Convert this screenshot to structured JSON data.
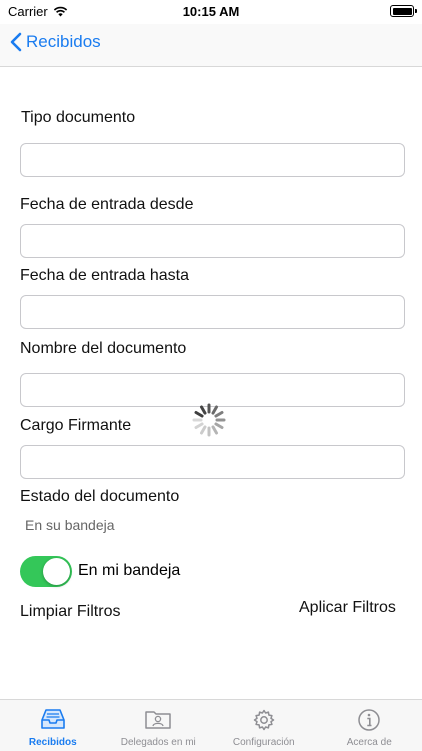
{
  "status_bar": {
    "carrier": "Carrier",
    "time": "10:15 AM"
  },
  "nav": {
    "back_label": "Recibidos"
  },
  "form": {
    "tipo_documento": {
      "label": "Tipo documento",
      "value": ""
    },
    "fecha_desde": {
      "label": "Fecha de entrada desde",
      "value": ""
    },
    "fecha_hasta": {
      "label": "Fecha de entrada hasta",
      "value": ""
    },
    "nombre_documento": {
      "label": "Nombre del documento",
      "value": ""
    },
    "cargo_firmante": {
      "label": "Cargo Firmante",
      "value": ""
    },
    "estado_documento": {
      "label": "Estado del documento",
      "value": "En su bandeja"
    }
  },
  "toggle": {
    "label": "En mi bandeja",
    "on": true
  },
  "actions": {
    "clear_label": "Limpiar Filtros",
    "apply_label": "Aplicar Filtros"
  },
  "tab_bar": {
    "items": [
      {
        "label": "Recibidos",
        "icon": "inbox-icon",
        "active": true
      },
      {
        "label": "Delegados en mi",
        "icon": "contacts-folder-icon",
        "active": false
      },
      {
        "label": "Configuración",
        "icon": "gear-icon",
        "active": false
      },
      {
        "label": "Acerca de",
        "icon": "info-icon",
        "active": false
      }
    ]
  },
  "colors": {
    "accent": "#1a7cf0",
    "toggle_on": "#34c759",
    "tab_inactive": "#8e8e93"
  }
}
